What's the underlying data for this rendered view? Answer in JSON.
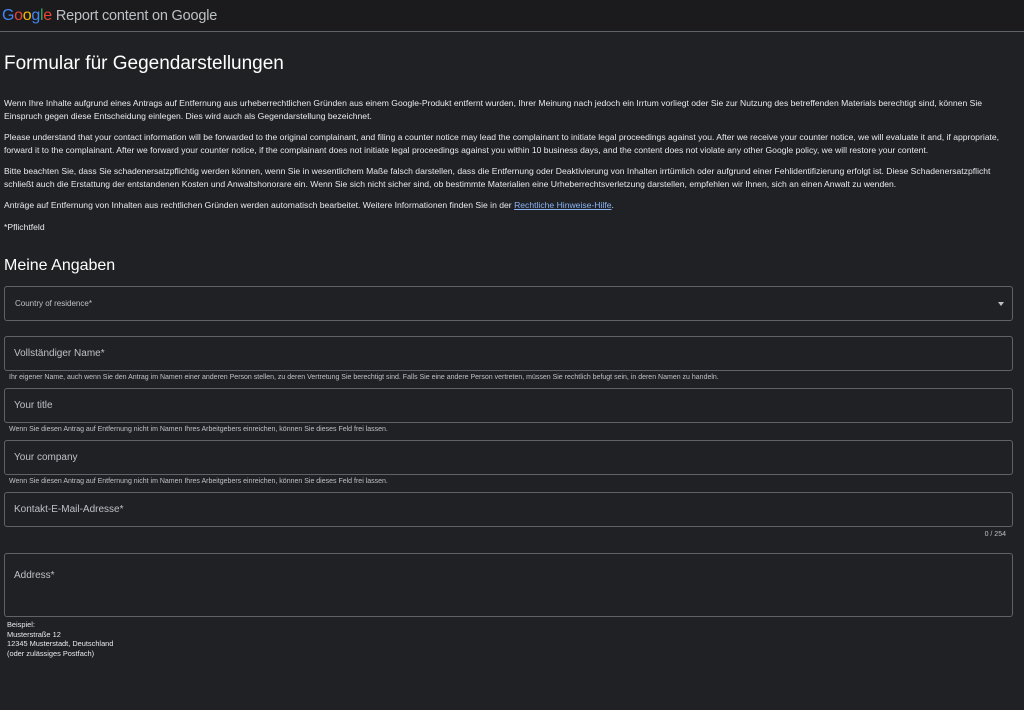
{
  "header": {
    "logo": "Google",
    "title": "Report content on Google",
    "colors": {
      "blue": "#4285F4",
      "red": "#EA4335",
      "yellow": "#FBBC05",
      "green": "#34A853"
    }
  },
  "form": {
    "title": "Formular für Gegendarstellungen",
    "intro": [
      "Wenn Ihre Inhalte aufgrund eines Antrags auf Entfernung aus urheberrechtlichen Gründen aus einem Google-Produkt entfernt wurden, Ihrer Meinung nach jedoch ein Irrtum vorliegt oder Sie zur Nutzung des betreffenden Materials berechtigt sind, können Sie Einspruch gegen diese Entscheidung einlegen. Dies wird auch als Gegendarstellung bezeichnet.",
      "Please understand that your contact information will be forwarded to the original complainant, and filing a counter notice may lead the complainant to initiate legal proceedings against you. After we receive your counter notice, we will evaluate it and, if appropriate, forward it to the complainant. After we forward your counter notice, if the complainant does not initiate legal proceedings against you within 10 business days, and the content does not violate any other Google policy, we will restore your content.",
      "Bitte beachten Sie, dass Sie schadenersatzpflichtig werden können, wenn Sie in wesentlichem Maße falsch darstellen, dass die Entfernung oder Deaktivierung von Inhalten irrtümlich oder aufgrund einer Fehlidentifizierung erfolgt ist. Diese Schadenersatzpflicht schließt auch die Erstattung der entstandenen Kosten und Anwaltshonorare ein. Wenn Sie sich nicht sicher sind, ob bestimmte Materialien eine Urheberrechtsverletzung darstellen, empfehlen wir Ihnen, sich an einen Anwalt zu wenden."
    ],
    "auto_text": "Anträge auf Entfernung von Inhalten aus rechtlichen Gründen werden automatisch bearbeitet. Weitere Informationen finden Sie in der ",
    "auto_link": "Rechtliche Hinweise-Hilfe",
    "auto_end": ".",
    "required_note": "*Pflichtfeld",
    "section_title": "Meine Angaben",
    "country_label": "Country of residence*",
    "name_label": "Vollständiger Name*",
    "name_helper": "Ihr eigener Name, auch wenn Sie den Antrag im Namen einer anderen Person stellen, zu deren Vertretung Sie berechtigt sind. Falls Sie eine andere Person vertreten, müssen Sie rechtlich befugt sein, in deren Namen zu handeln.",
    "title_label": "Your title",
    "title_helper": "Wenn Sie diesen Antrag auf Entfernung nicht im Namen Ihres Arbeitgebers einreichen, können Sie dieses Feld frei lassen.",
    "company_label": "Your company",
    "company_helper": "Wenn Sie diesen Antrag auf Entfernung nicht im Namen Ihres Arbeitgebers einreichen, können Sie dieses Feld frei lassen.",
    "email_label": "Kontakt-E-Mail-Adresse*",
    "email_counter": "0 / 254",
    "address_label": "Address*",
    "address_example": [
      "Beispiel:",
      "Musterstraße 12",
      "12345 Musterstadt, Deutschland",
      "(oder zulässiges Postfach)"
    ]
  }
}
